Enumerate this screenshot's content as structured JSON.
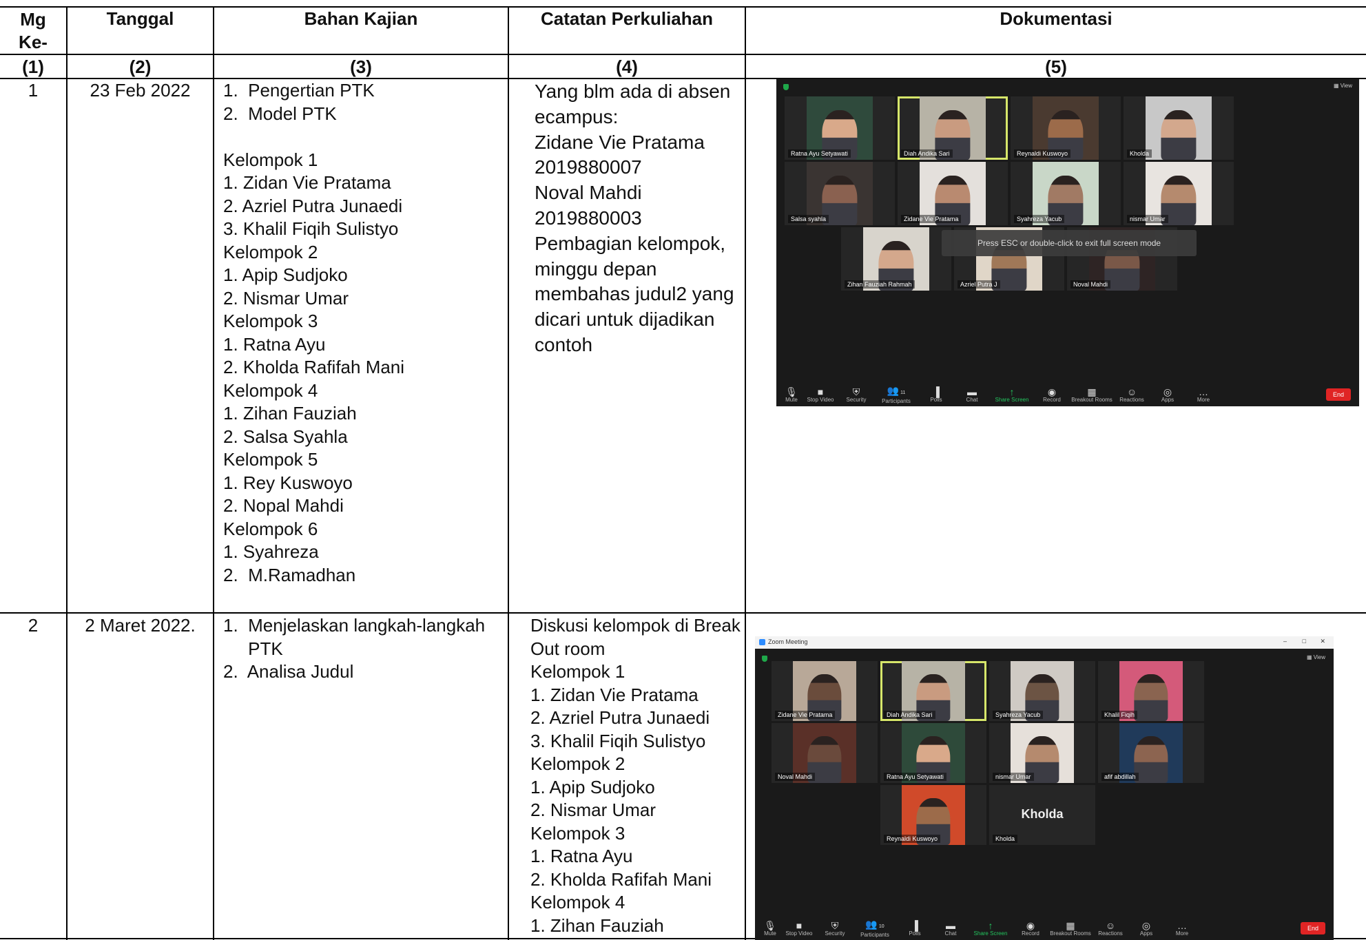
{
  "headers": {
    "col1": "Mg\nKe-",
    "col2": "Tanggal",
    "col3": "Bahan Kajian",
    "col4": "Catatan Perkuliahan",
    "col5": "Dokumentasi"
  },
  "numbers": [
    "(1)",
    "(2)",
    "(3)",
    "(4)",
    "(5)"
  ],
  "rows": [
    {
      "mg": "1",
      "tanggal": "23 Feb 2022",
      "bahan": "1.  Pengertian PTK\n2.  Model PTK\n\nKelompok 1\n1. Zidan Vie Pratama\n2. Azriel Putra Junaedi\n3. Khalil Fiqih Sulistyo\nKelompok 2\n1. Apip Sudjoko\n2. Nismar Umar\nKelompok 3\n1. Ratna Ayu\n2. Kholda Rafifah Mani\nKelompok 4\n1. Zihan Fauziah\n2. Salsa Syahla\nKelompok 5\n1. Rey Kuswoyo\n2. Nopal Mahdi\nKelompok 6\n1. Syahreza\n2.  M.Ramadhan",
      "catatan": "Yang blm ada di absen\necampus:\nZidane Vie Pratama\n2019880007\nNoval Mahdi\n2019880003\nPembagian kelompok,\nminggu depan\nmembahas judul2 yang\ndicari untuk dijadikan\ncontoh"
    },
    {
      "mg": "2",
      "tanggal": "2 Maret 2022.",
      "bahan": "1.  Menjelaskan langkah-langkah\n     PTK\n2.  Analisa Judul",
      "catatan": "Diskusi kelompok di Break\nOut room\nKelompok 1\n1. Zidan Vie Pratama\n2. Azriel Putra Junaedi\n3. Khalil Fiqih Sulistyo\nKelompok 2\n1. Apip Sudjoko\n2. Nismar Umar\nKelompok 3\n1. Ratna Ayu\n2. Kholda Rafifah Mani\nKelompok 4\n1. Zihan Fauziah"
    }
  ],
  "zoom1": {
    "view_label": "View",
    "overlay": "Press ESC or double-click to exit full screen mode",
    "tiles": [
      {
        "name": "Ratna Ayu Setyawati",
        "bg": "#2f4a3c",
        "skin": "#d9a98a"
      },
      {
        "name": "Diah Andika Sari",
        "bg": "#b7b3a6",
        "skin": "#c99b80"
      },
      {
        "name": "Reynaldi Kuswoyo",
        "bg": "#4a3a30",
        "skin": "#9c6b4a"
      },
      {
        "name": "Kholda",
        "bg": "#c8c8c8",
        "skin": "#d3a88d"
      },
      {
        "name": "Salsa syahla",
        "bg": "#3a3432",
        "skin": "#8a6150"
      },
      {
        "name": "Zidane Vie Pratama",
        "bg": "#e4e0dc",
        "skin": "#b98a70"
      },
      {
        "name": "Syahreza Yacub",
        "bg": "#c9d7c8",
        "skin": "#a17a64"
      },
      {
        "name": "nismar Umar",
        "bg": "#e8e4e0",
        "skin": "#b58a6e"
      },
      {
        "name": "Zihan Fauziah Rahmah",
        "bg": "#d8d4cc",
        "skin": "#d4a88c"
      },
      {
        "name": "Azriel Putra J",
        "bg": "#e0d6c8",
        "skin": "#a07858"
      },
      {
        "name": "Noval Mahdi",
        "bg": "#2e2424",
        "skin": "#7a5848"
      }
    ],
    "toolbar": [
      "Mute",
      "Stop Video",
      "Security",
      "Participants",
      "Polls",
      "Chat",
      "Share Screen",
      "Record",
      "Breakout Rooms",
      "Reactions",
      "Apps",
      "More"
    ],
    "participants_count": "11",
    "end_label": "End"
  },
  "zoom2": {
    "window_title": "Zoom Meeting",
    "view_label": "View",
    "tiles": [
      {
        "name": "Zidane Vie Pratama",
        "bg": "#b8a898",
        "skin": "#6a4c3c"
      },
      {
        "name": "Diah Andika Sari",
        "bg": "#b7b3a6",
        "skin": "#c99b80"
      },
      {
        "name": "Syahreza Yacub",
        "bg": "#cfcac4",
        "skin": "#6c5444"
      },
      {
        "name": "Khalil Fiqih",
        "bg": "#d45a7a",
        "skin": "#8a6450"
      },
      {
        "name": "Noval Mahdi",
        "bg": "#5a3028",
        "skin": "#6a4a3c"
      },
      {
        "name": "Ratna Ayu Setyawati",
        "bg": "#2e4a3a",
        "skin": "#d9a98a"
      },
      {
        "name": "nismar Umar",
        "bg": "#e6e0da",
        "skin": "#b58a6e"
      },
      {
        "name": "afif abdillah",
        "bg": "#203a5a",
        "skin": "#8c6450"
      },
      {
        "name": "Reynaldi Kuswoyo",
        "bg": "#d04a2a",
        "skin": "#9c6b4a"
      },
      {
        "name": "Kholda",
        "bg": "#262626",
        "skin": ""
      }
    ],
    "big_name": "Kholda",
    "toolbar": [
      "Mute",
      "Stop Video",
      "Security",
      "Participants",
      "Polls",
      "Chat",
      "Share Screen",
      "Record",
      "Breakout Rooms",
      "Reactions",
      "Apps",
      "More"
    ],
    "participants_count": "10",
    "end_label": "End"
  }
}
